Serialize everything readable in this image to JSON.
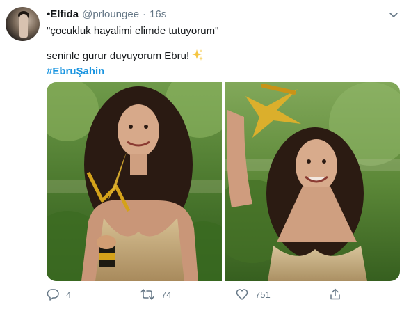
{
  "tweet": {
    "display_name": "•Elfida",
    "handle": "@prloungee",
    "separator": "·",
    "time": "16s",
    "lines": [
      "\"çocukluk hayalimi elimde tutuyorum\"",
      "seninle gurur duyuyorum Ebru!"
    ],
    "emoji_icon": "sparkles-icon",
    "hashtag": "#EbruŞahin",
    "accent_color": "#1b95e0",
    "actions": {
      "reply_count": "4",
      "retweet_count": "74",
      "like_count": "751"
    }
  }
}
